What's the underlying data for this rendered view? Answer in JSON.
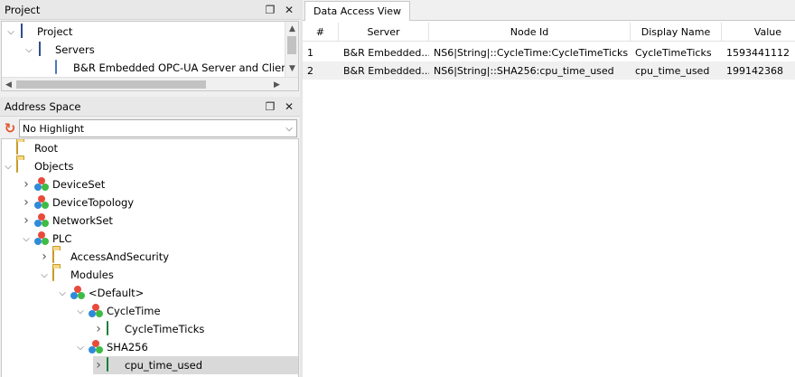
{
  "project_panel": {
    "title": "Project",
    "tree": [
      {
        "label": "Project",
        "icon": "doc",
        "depth": 0,
        "arrow": "down"
      },
      {
        "label": "Servers",
        "icon": "doc",
        "depth": 1,
        "arrow": "down"
      },
      {
        "label": "B&R Embedded OPC-UA Server and Client",
        "icon": "server",
        "depth": 2,
        "arrow": ""
      }
    ]
  },
  "address_panel": {
    "title": "Address Space",
    "highlight_value": "No Highlight",
    "tree": [
      {
        "label": "Root",
        "icon": "folder",
        "depth": 0,
        "arrow": ""
      },
      {
        "label": "Objects",
        "icon": "folder",
        "depth": 0,
        "arrow": "down"
      },
      {
        "label": "DeviceSet",
        "icon": "object",
        "depth": 1,
        "arrow": "right"
      },
      {
        "label": "DeviceTopology",
        "icon": "object",
        "depth": 1,
        "arrow": "right"
      },
      {
        "label": "NetworkSet",
        "icon": "object",
        "depth": 1,
        "arrow": "right"
      },
      {
        "label": "PLC",
        "icon": "object",
        "depth": 1,
        "arrow": "down"
      },
      {
        "label": "AccessAndSecurity",
        "icon": "folder",
        "depth": 2,
        "arrow": "right"
      },
      {
        "label": "Modules",
        "icon": "folder",
        "depth": 2,
        "arrow": "down"
      },
      {
        "label": "<Default>",
        "icon": "object",
        "depth": 3,
        "arrow": "down"
      },
      {
        "label": "CycleTime",
        "icon": "object",
        "depth": 4,
        "arrow": "down"
      },
      {
        "label": "CycleTimeTicks",
        "icon": "variable",
        "depth": 5,
        "arrow": "right"
      },
      {
        "label": "SHA256",
        "icon": "object",
        "depth": 4,
        "arrow": "down"
      },
      {
        "label": "cpu_time_used",
        "icon": "variable",
        "depth": 5,
        "arrow": "right",
        "selected": true
      }
    ]
  },
  "data_access_view": {
    "tab_label": "Data Access View",
    "columns": [
      "#",
      "Server",
      "Node Id",
      "Display Name",
      "Value"
    ],
    "rows": [
      [
        "1",
        "B&R Embedded...",
        "NS6|String|::CycleTime:CycleTimeTicks",
        "CycleTimeTicks",
        "1593441112"
      ],
      [
        "2",
        "B&R Embedded...",
        "NS6|String|::SHA256:cpu_time_used",
        "cpu_time_used",
        "199142368"
      ]
    ]
  },
  "icons": {
    "restore": "restore-icon",
    "close": "close-icon",
    "refresh": "refresh-icon"
  }
}
